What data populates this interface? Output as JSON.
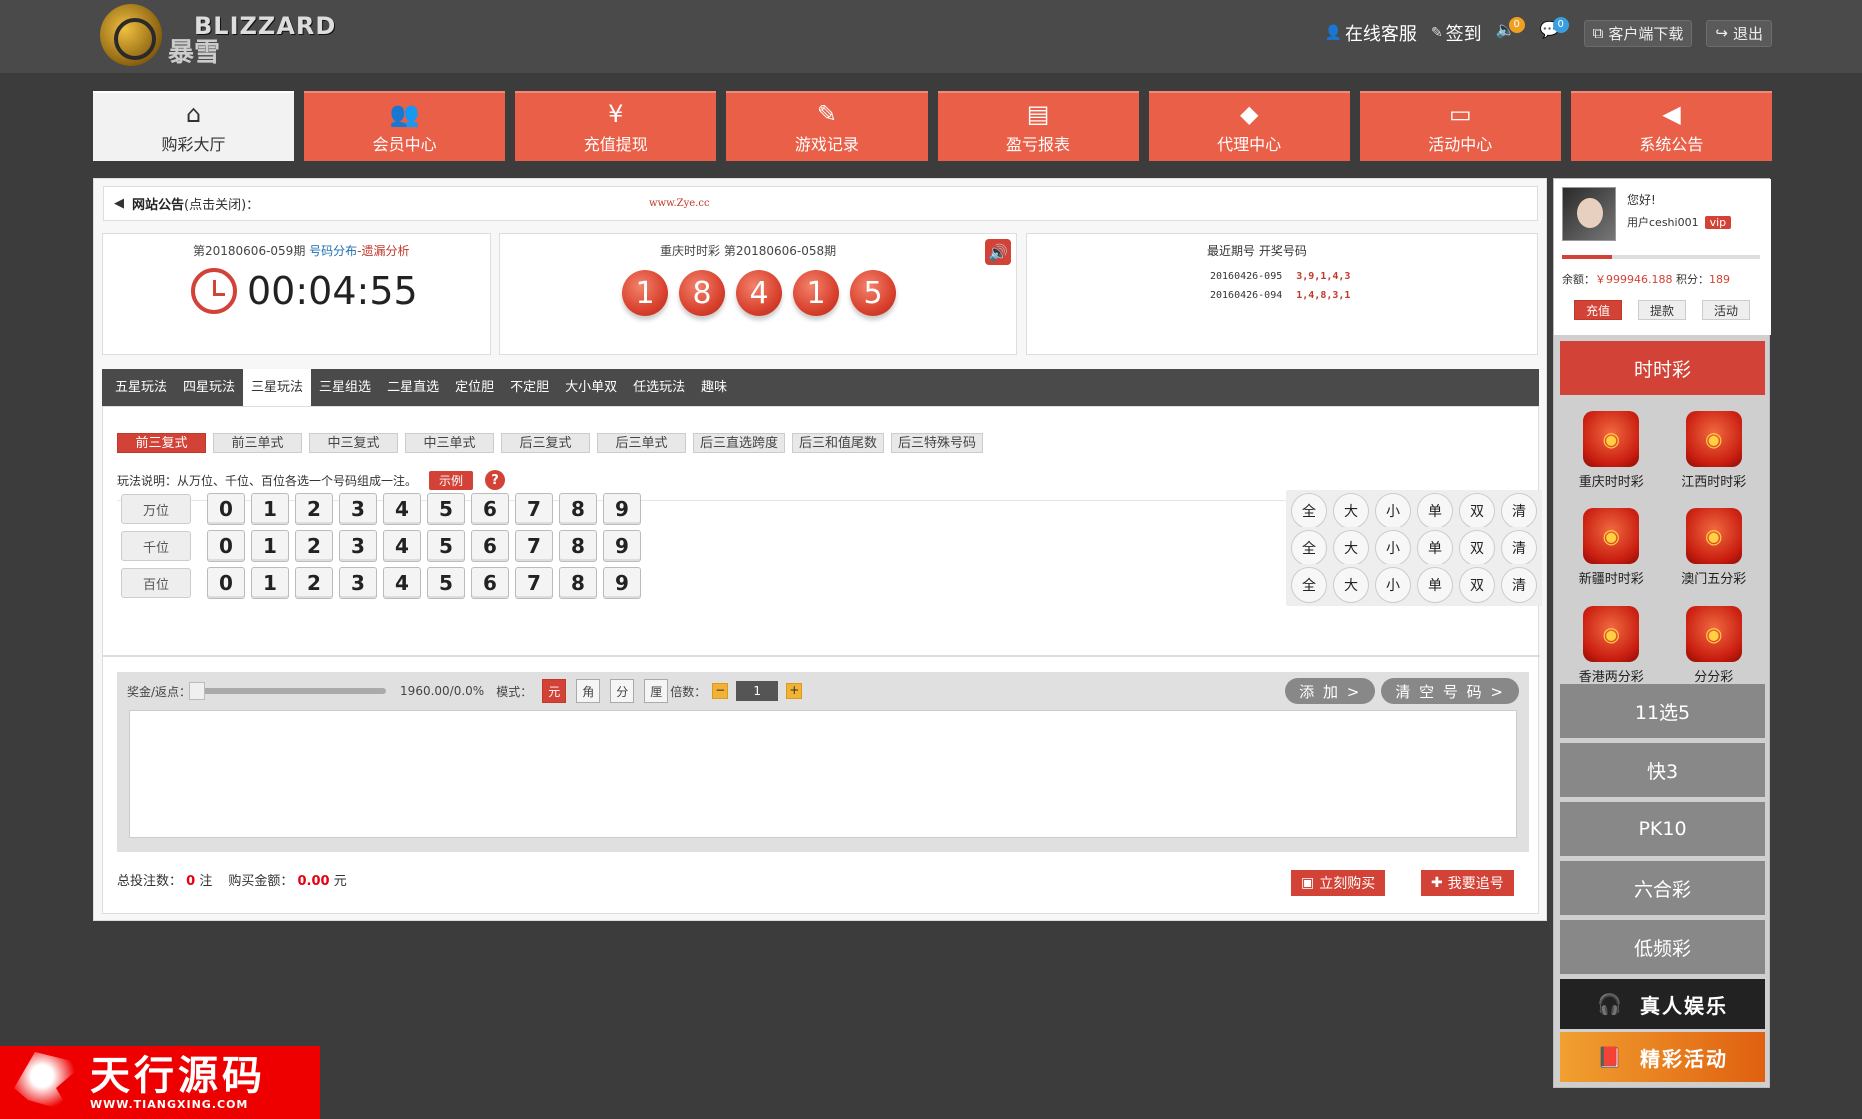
{
  "header": {
    "logo_text": "BLIZZARD",
    "logo_cn": "暴雪",
    "links": [
      {
        "label": "在线客服",
        "icon": "person-icon"
      },
      {
        "label": "签到",
        "icon": "pen-icon"
      }
    ],
    "sound_count": "0",
    "message_count": "0",
    "download_label": "客户端下载",
    "logout_label": "退出"
  },
  "nav": [
    {
      "label": "购彩大厅",
      "icon": "home-icon",
      "glyph": "⌂",
      "active": true
    },
    {
      "label": "会员中心",
      "icon": "users-icon",
      "glyph": "👥",
      "active": false
    },
    {
      "label": "充值提现",
      "icon": "yen-icon",
      "glyph": "¥",
      "active": false
    },
    {
      "label": "游戏记录",
      "icon": "edit-icon",
      "glyph": "✎",
      "active": false
    },
    {
      "label": "盈亏报表",
      "icon": "report-icon",
      "glyph": "▤",
      "active": false
    },
    {
      "label": "代理中心",
      "icon": "diamond-icon",
      "glyph": "◆",
      "active": false
    },
    {
      "label": "活动中心",
      "icon": "monitor-icon",
      "glyph": "▭",
      "active": false
    },
    {
      "label": "系统公告",
      "icon": "speaker-icon",
      "glyph": "◀",
      "active": false
    }
  ],
  "notice": {
    "title": "网站公告",
    "hint": "(点击关闭)：",
    "url": "www.Zye.cc"
  },
  "countdown": {
    "period_label": "第20180606-059期",
    "link_dist": "号码分布",
    "link_dash": "-",
    "link_miss": "遗漏分析",
    "time": "00:04:55"
  },
  "draw": {
    "title": "重庆时时彩  第20180606-058期",
    "balls": [
      "1",
      "8",
      "4",
      "1",
      "5"
    ]
  },
  "recent": {
    "header_period": "最近期号",
    "header_numbers": "开奖号码",
    "rows": [
      {
        "period": "20160426-095",
        "numbers": "3,9,1,4,3"
      },
      {
        "period": "20160426-094",
        "numbers": "1,4,8,3,1"
      }
    ]
  },
  "play_tabs": [
    "五星玩法",
    "四星玩法",
    "三星玩法",
    "三星组选",
    "二星直选",
    "定位胆",
    "不定胆",
    "大小单双",
    "任选玩法",
    "趣味"
  ],
  "active_play_tab": 2,
  "sub_tabs": [
    "前三复式",
    "前三单式",
    "中三复式",
    "中三单式",
    "后三复式",
    "后三单式",
    "后三直选跨度",
    "后三和值尾数",
    "后三特殊号码"
  ],
  "active_sub_tab": 0,
  "explain": {
    "text": "玩法说明：从万位、千位、百位各选一个号码组成一注。",
    "example": "示例",
    "help": "?"
  },
  "digits": [
    "0",
    "1",
    "2",
    "3",
    "4",
    "5",
    "6",
    "7",
    "8",
    "9"
  ],
  "positions": [
    "万位",
    "千位",
    "百位"
  ],
  "quick": [
    "全",
    "大",
    "小",
    "单",
    "双",
    "清"
  ],
  "bet": {
    "rebate_label": "奖金/返点：",
    "rebate_value": "1960.00/0.0%",
    "mode_label": "模式：",
    "modes": [
      "元",
      "角",
      "分",
      "厘"
    ],
    "mult_label": "倍数：",
    "mult_value": "1",
    "add_label": "添 加 >",
    "clear_label": "清 空 号 码 >"
  },
  "totals": {
    "count_label": "总投注数：",
    "count": "0",
    "count_unit": "注",
    "amount_label": "购买金额：",
    "amount": "0.00",
    "amount_unit": "元"
  },
  "actions": {
    "buy": "立刻购买",
    "chase": "我要追号"
  },
  "user": {
    "greeting": "您好!",
    "name": "用户ceshi001",
    "vip": "vip",
    "progress_fraction": 0.25,
    "balance_label": "余额：",
    "balance": "￥999946.188",
    "points_label": "积分：",
    "points": "189",
    "buttons": [
      "充值",
      "提款",
      "活动"
    ]
  },
  "categories": {
    "ssc": "时时彩",
    "games": [
      "重庆时时彩",
      "江西时时彩",
      "新疆时时彩",
      "澳门五分彩",
      "香港两分彩",
      "分分彩"
    ],
    "others": [
      "11选5",
      "快3",
      "PK10",
      "六合彩",
      "低频彩"
    ],
    "live": "真人娱乐",
    "events": "精彩活动"
  },
  "watermark": {
    "title": "天行源码",
    "url": "WWW.TIANGXING.COM"
  }
}
